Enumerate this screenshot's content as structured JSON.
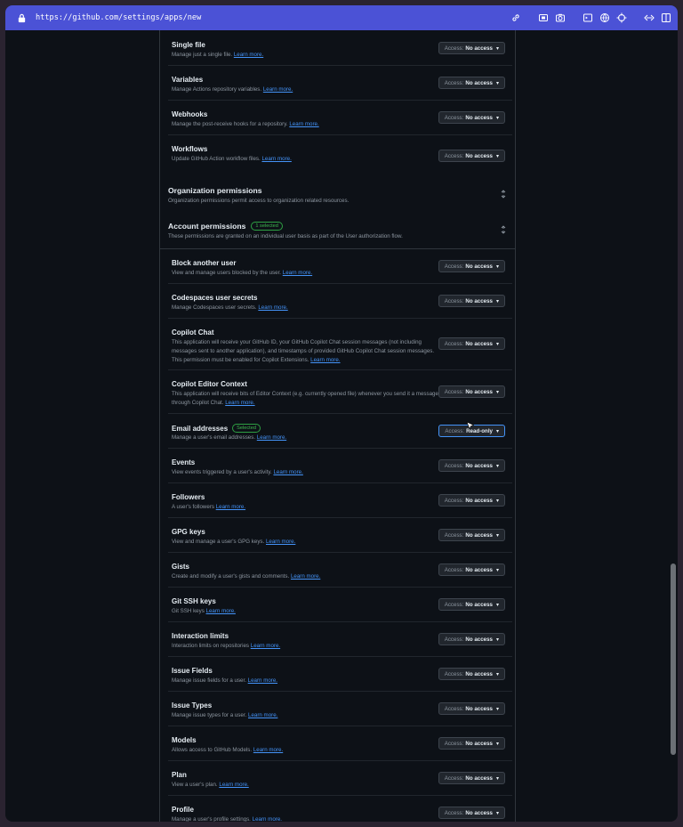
{
  "browser": {
    "url": "https://github.com/settings/apps/new"
  },
  "repo_rows": [
    {
      "title": "Single file",
      "desc": "Manage just a single file.",
      "learn": "Learn more.",
      "access_label": "Access:",
      "access_value": "No access"
    },
    {
      "title": "Variables",
      "desc": "Manage Actions repository variables.",
      "learn": "Learn more.",
      "access_label": "Access:",
      "access_value": "No access"
    },
    {
      "title": "Webhooks",
      "desc": "Manage the post-receive hooks for a repository.",
      "learn": "Learn more.",
      "access_label": "Access:",
      "access_value": "No access"
    },
    {
      "title": "Workflows",
      "desc": "Update GitHub Action workflow files.",
      "learn": "Learn more.",
      "access_label": "Access:",
      "access_value": "No access"
    }
  ],
  "org_section": {
    "title": "Organization permissions",
    "desc": "Organization permissions permit access to organization related resources."
  },
  "account_section": {
    "title": "Account permissions",
    "badge": "1 selected",
    "desc": "These permissions are granted on an individual user basis as part of the User authorization flow."
  },
  "account_rows": [
    {
      "title": "Block another user",
      "desc": "View and manage users blocked by the user.",
      "learn": "Learn more.",
      "access_label": "Access:",
      "access_value": "No access"
    },
    {
      "title": "Codespaces user secrets",
      "desc": "Manage Codespaces user secrets.",
      "learn": "Learn more.",
      "access_label": "Access:",
      "access_value": "No access"
    },
    {
      "title": "Copilot Chat",
      "desc": "This application will receive your GitHub ID, your GitHub Copilot Chat session messages (not including messages sent to another application), and timestamps of provided GitHub Copilot Chat session messages. This permission must be enabled for Copilot Extensions.",
      "learn": "Learn more.",
      "access_label": "Access:",
      "access_value": "No access"
    },
    {
      "title": "Copilot Editor Context",
      "desc": "This application will receive bits of Editor Context (e.g. currently opened file) whenever you send it a message through Copilot Chat.",
      "learn": "Learn more.",
      "access_label": "Access:",
      "access_value": "No access"
    },
    {
      "title": "Email addresses",
      "badge": "Selected",
      "desc": "Manage a user's email addresses.",
      "learn": "Learn more.",
      "access_label": "Access:",
      "access_value": "Read-only"
    },
    {
      "title": "Events",
      "desc": "View events triggered by a user's activity.",
      "learn": "Learn more.",
      "access_label": "Access:",
      "access_value": "No access"
    },
    {
      "title": "Followers",
      "desc": "A user's followers",
      "learn": "Learn more.",
      "access_label": "Access:",
      "access_value": "No access"
    },
    {
      "title": "GPG keys",
      "desc": "View and manage a user's GPG keys.",
      "learn": "Learn more.",
      "access_label": "Access:",
      "access_value": "No access"
    },
    {
      "title": "Gists",
      "desc": "Create and modify a user's gists and comments.",
      "learn": "Learn more.",
      "access_label": "Access:",
      "access_value": "No access"
    },
    {
      "title": "Git SSH keys",
      "desc": "Git SSH keys",
      "learn": "Learn more.",
      "access_label": "Access:",
      "access_value": "No access"
    },
    {
      "title": "Interaction limits",
      "desc": "Interaction limits on repositories",
      "learn": "Learn more.",
      "access_label": "Access:",
      "access_value": "No access"
    },
    {
      "title": "Issue Fields",
      "desc": "Manage issue fields for a user.",
      "learn": "Learn more.",
      "access_label": "Access:",
      "access_value": "No access"
    },
    {
      "title": "Issue Types",
      "desc": "Manage issue types for a user.",
      "learn": "Learn more.",
      "access_label": "Access:",
      "access_value": "No access"
    },
    {
      "title": "Models",
      "desc": "Allows access to GitHub Models.",
      "learn": "Learn more.",
      "access_label": "Access:",
      "access_value": "No access"
    },
    {
      "title": "Plan",
      "desc": "View a user's plan.",
      "learn": "Learn more.",
      "access_label": "Access:",
      "access_value": "No access"
    },
    {
      "title": "Profile",
      "desc": "Manage a user's profile settings.",
      "learn": "Learn more.",
      "access_label": "Access:",
      "access_value": "No access"
    }
  ]
}
